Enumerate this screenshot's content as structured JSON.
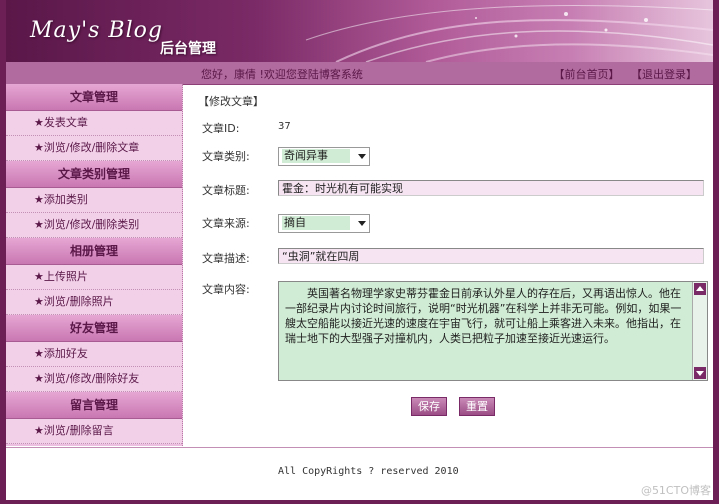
{
  "header": {
    "logo_text": "May's Blog",
    "logo_sub": "后台管理"
  },
  "topbar": {
    "welcome": "您好，康倩 !欢迎您登陆博客系统",
    "home_link": "【前台首页】",
    "logout_link": "【退出登录】"
  },
  "sidebar": {
    "sections": [
      {
        "title": "文章管理",
        "items": [
          "★发表文章",
          "★浏览/修改/删除文章"
        ]
      },
      {
        "title": "文章类别管理",
        "items": [
          "★添加类别",
          "★浏览/修改/删除类别"
        ]
      },
      {
        "title": "相册管理",
        "items": [
          "★上传照片",
          "★浏览/删除照片"
        ]
      },
      {
        "title": "好友管理",
        "items": [
          "★添加好友",
          "★浏览/修改/删除好友"
        ]
      },
      {
        "title": "留言管理",
        "items": [
          "★浏览/删除留言"
        ]
      }
    ]
  },
  "main": {
    "breadcrumb": "【修改文章】",
    "id_label": "文章ID:",
    "id_value": "37",
    "category_label": "文章类别:",
    "category_value": "奇闻异事",
    "title_label": "文章标题:",
    "title_value": "霍金：时光机有可能实现",
    "source_label": "文章来源:",
    "source_value": "摘自",
    "desc_label": "文章描述:",
    "desc_value": "“虫洞”就在四周",
    "content_label": "文章内容:",
    "content_value": "　　英国著名物理学家史蒂芬霍金日前承认外星人的存在后，又再语出惊人。他在一部纪录片内讨论时间旅行，说明“时光机器”在科学上并非无可能。例如，如果一艘太空船能以接近光速的速度在宇宙飞行，就可让船上乘客进入未来。他指出，在瑞士地下的大型强子对撞机内，人类已把粒子加速至接近光速运行。",
    "save_button": "保存",
    "reset_button": "重置"
  },
  "footer": {
    "copyright": "All CopyRights ? reserved 2010",
    "watermark": "@51CTO博客"
  }
}
